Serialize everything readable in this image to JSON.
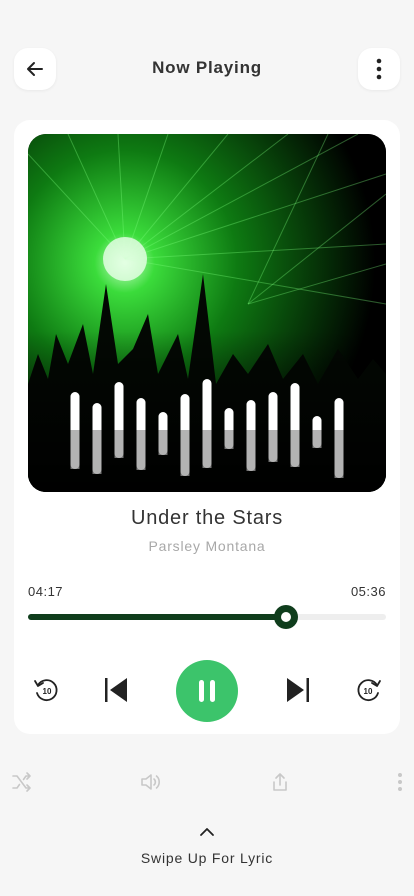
{
  "header": {
    "title": "Now Playing",
    "back_icon": "arrow-left-icon",
    "menu_icon": "vertical-dots-icon"
  },
  "track": {
    "title": "Under the Stars",
    "artist": "Parsley Montana"
  },
  "progress": {
    "elapsed": "04:17",
    "total": "05:36",
    "fraction": 0.72
  },
  "controls": {
    "rewind_seconds": "10",
    "forward_seconds": "10",
    "state": "playing"
  },
  "secondary": [
    "shuffle-icon",
    "volume-icon",
    "share-icon",
    "more-icon"
  ],
  "footer": {
    "label": "Swipe Up For Lyric"
  },
  "colors": {
    "accent": "#3cc46b",
    "progress": "#0f3d1c",
    "background": "#f6f6f6"
  }
}
